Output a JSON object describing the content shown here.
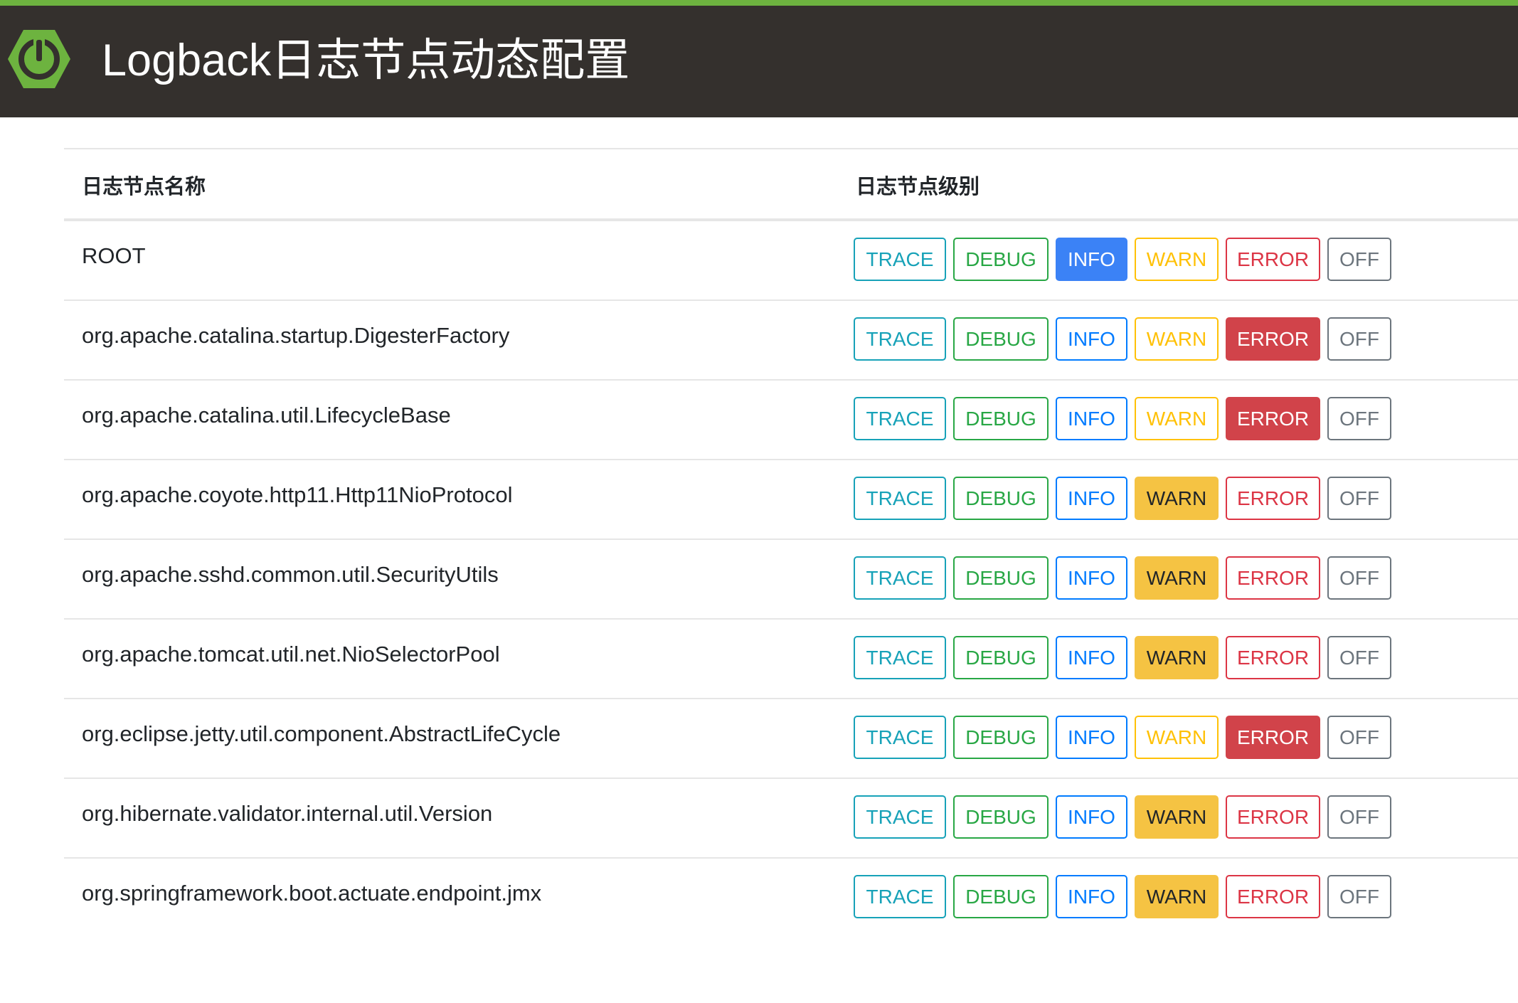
{
  "header": {
    "title": "Logback日志节点动态配置",
    "logo_icon": "spring-power-icon",
    "accent_color": "#6db33f",
    "background_color": "#34302d"
  },
  "table": {
    "headers": {
      "name": "日志节点名称",
      "level": "日志节点级别"
    },
    "levels": [
      "TRACE",
      "DEBUG",
      "INFO",
      "WARN",
      "ERROR",
      "OFF"
    ],
    "rows": [
      {
        "name": "ROOT",
        "active": "INFO"
      },
      {
        "name": "org.apache.catalina.startup.DigesterFactory",
        "active": "ERROR"
      },
      {
        "name": "org.apache.catalina.util.LifecycleBase",
        "active": "ERROR"
      },
      {
        "name": "org.apache.coyote.http11.Http11NioProtocol",
        "active": "WARN"
      },
      {
        "name": "org.apache.sshd.common.util.SecurityUtils",
        "active": "WARN"
      },
      {
        "name": "org.apache.tomcat.util.net.NioSelectorPool",
        "active": "WARN"
      },
      {
        "name": "org.eclipse.jetty.util.component.AbstractLifeCycle",
        "active": "ERROR"
      },
      {
        "name": "org.hibernate.validator.internal.util.Version",
        "active": "WARN"
      },
      {
        "name": "org.springframework.boot.actuate.endpoint.jmx",
        "active": "WARN"
      }
    ]
  },
  "colors": {
    "trace": "#17a2b8",
    "debug": "#28a745",
    "info": "#007bff",
    "warn": "#ffc107",
    "error": "#dc3545",
    "off": "#6c757d"
  }
}
